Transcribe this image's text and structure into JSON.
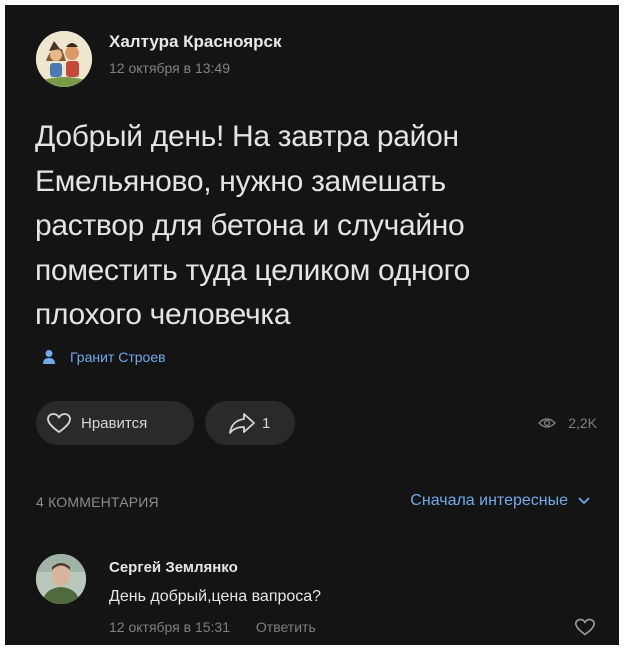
{
  "post": {
    "group_name": "Халтура Красноярск",
    "date": "12 октября в 13:49",
    "text_lines": [
      "Добрый день! На завтра район",
      "Емельяново, нужно замешать",
      "раствор для бетона и случайно",
      "поместить туда целиком одного",
      "плохого человечка"
    ],
    "author": "Гранит Строев",
    "like_label": "Нравится",
    "shares": "1",
    "views": "2,2K"
  },
  "comments_header": {
    "count_label": "4 КОММЕНТАРИЯ",
    "sort_label": "Сначала интересные"
  },
  "comment": {
    "name": "Сергей Землянко",
    "text": "День добрый,цена вапроса?",
    "date": "12 октября в 15:31",
    "reply_label": "Ответить"
  },
  "colors": {
    "background": "#141414",
    "accent": "#71aaeb",
    "muted": "#808080",
    "pill": "#2a2a2a"
  },
  "icons": [
    "heart-icon",
    "share-icon",
    "eye-icon",
    "user-icon",
    "chevron-down-icon"
  ]
}
